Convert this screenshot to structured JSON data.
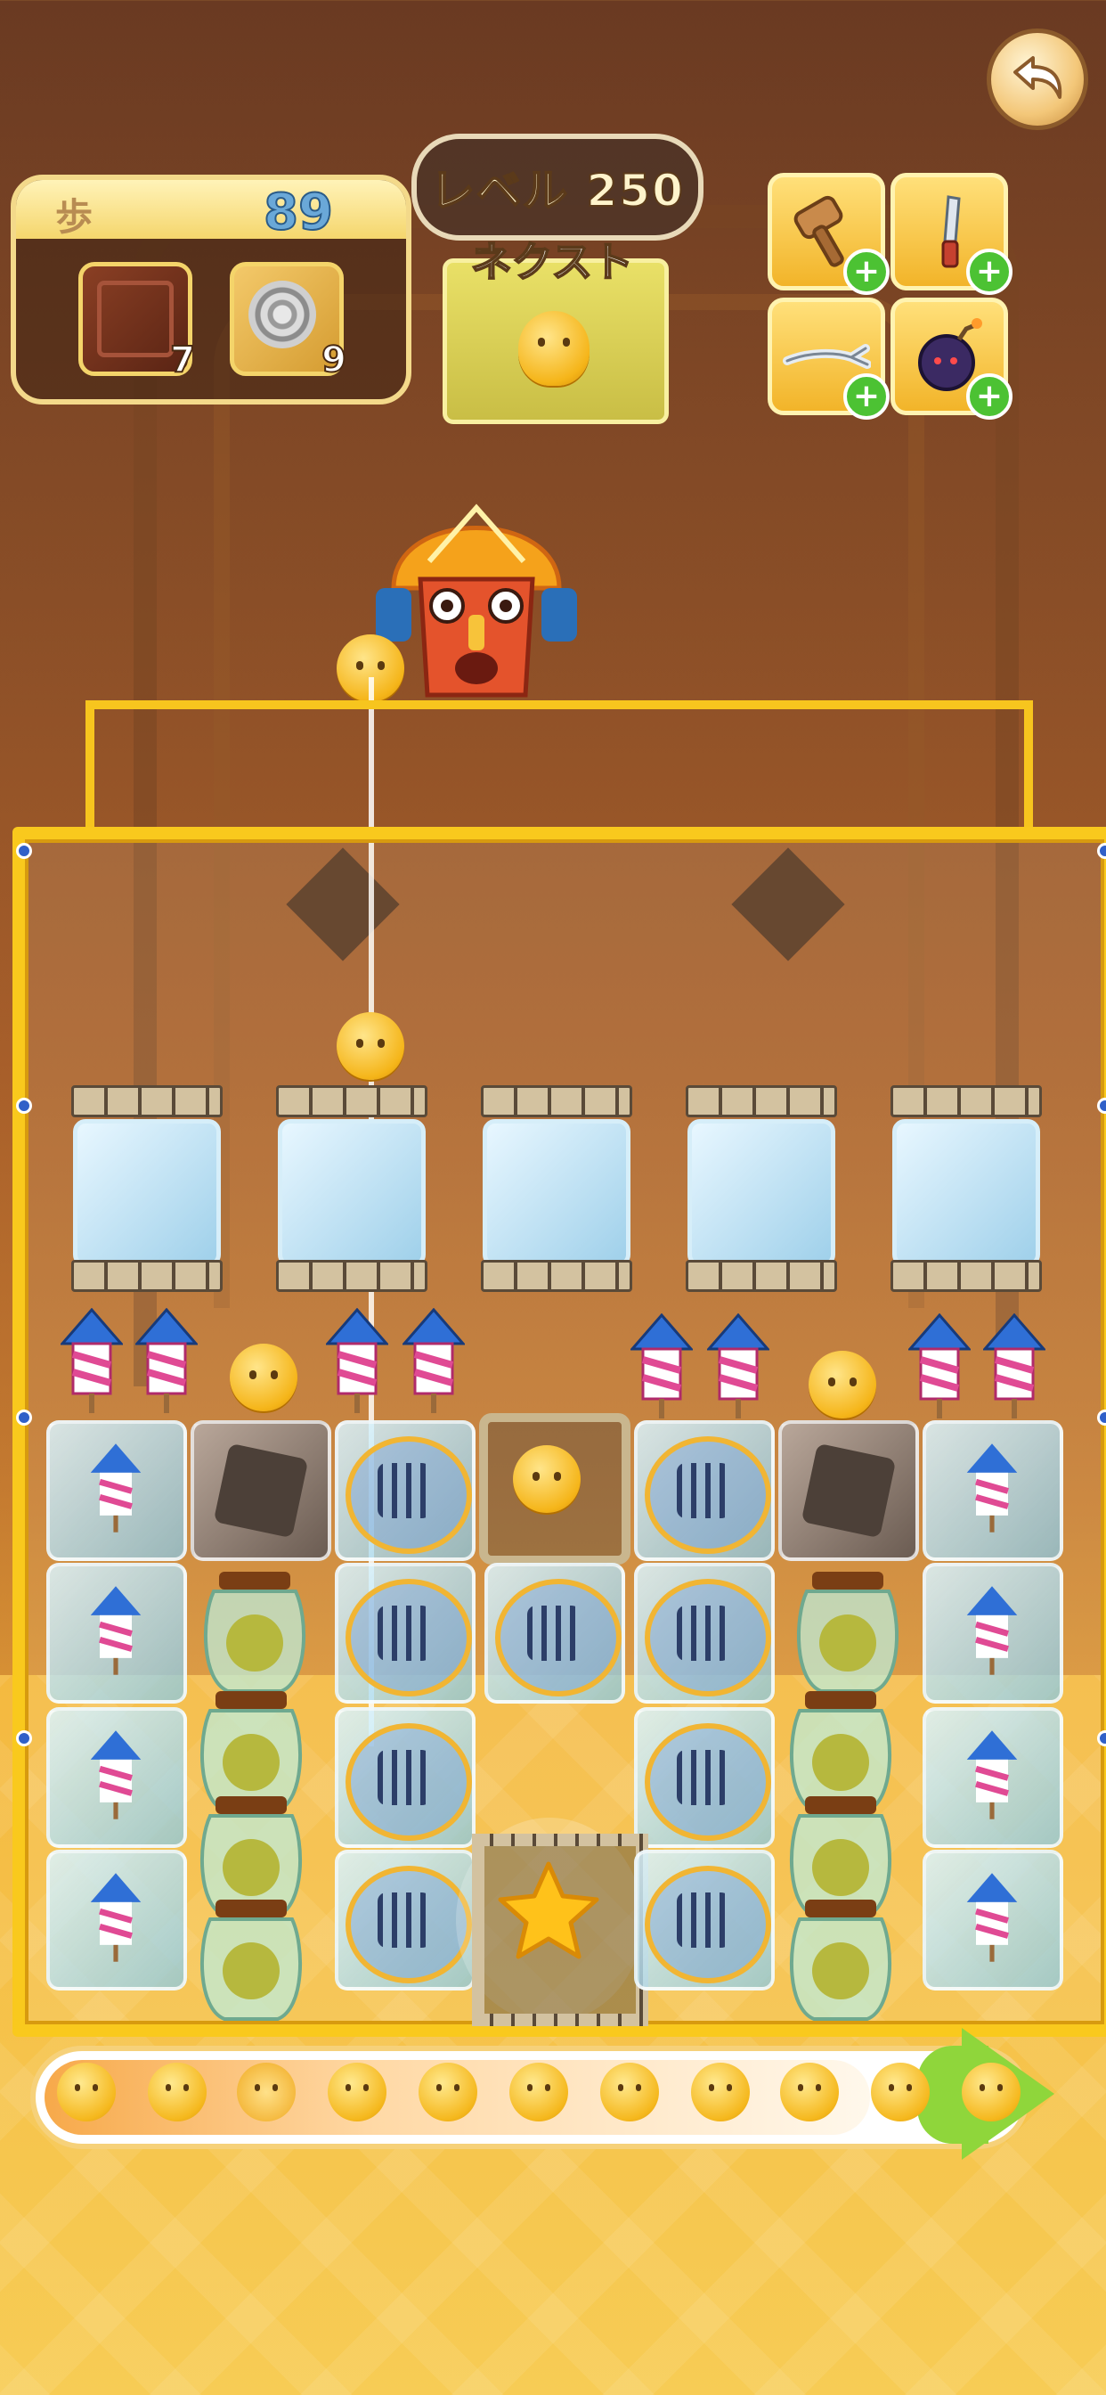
{
  "hud": {
    "moves_label": "歩",
    "moves_count": "89",
    "goals": [
      {
        "icon": "chocolate-block-icon",
        "count": "7"
      },
      {
        "icon": "metal-disc-icon",
        "count": "9"
      }
    ],
    "level_text": "レベル 250",
    "next_label": "ネクスト",
    "next_item": "yellow-candy-icon"
  },
  "boosters": [
    {
      "icon": "hammer-icon"
    },
    {
      "icon": "knife-icon"
    },
    {
      "icon": "grabber-icon"
    },
    {
      "icon": "bomb-icon"
    }
  ],
  "progress": {
    "level": 0.85,
    "faces": 11
  },
  "colors": {
    "frame_gold": "#f9c91d",
    "candy_yellow": "#f5b519",
    "booster_plus": "#4cc233",
    "progress_arrow": "#8fd63b"
  }
}
